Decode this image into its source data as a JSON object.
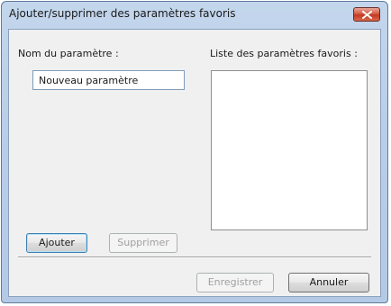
{
  "window": {
    "title": "Ajouter/supprimer des paramètres favoris",
    "close_icon": "close-icon"
  },
  "left_panel": {
    "name_label": "Nom du paramètre :",
    "name_value": "Nouveau paramètre",
    "add_button": "Ajouter",
    "remove_button": "Supprimer",
    "remove_enabled": false
  },
  "right_panel": {
    "list_label": "Liste des paramètres favoris :",
    "items": []
  },
  "footer": {
    "save_button": "Enregistrer",
    "save_enabled": false,
    "cancel_button": "Annuler"
  },
  "colors": {
    "title_bar": "#b9cee8",
    "close_button": "#c9452c",
    "client_background": "#f0f0f0",
    "disabled_text": "#a0a0a0"
  }
}
